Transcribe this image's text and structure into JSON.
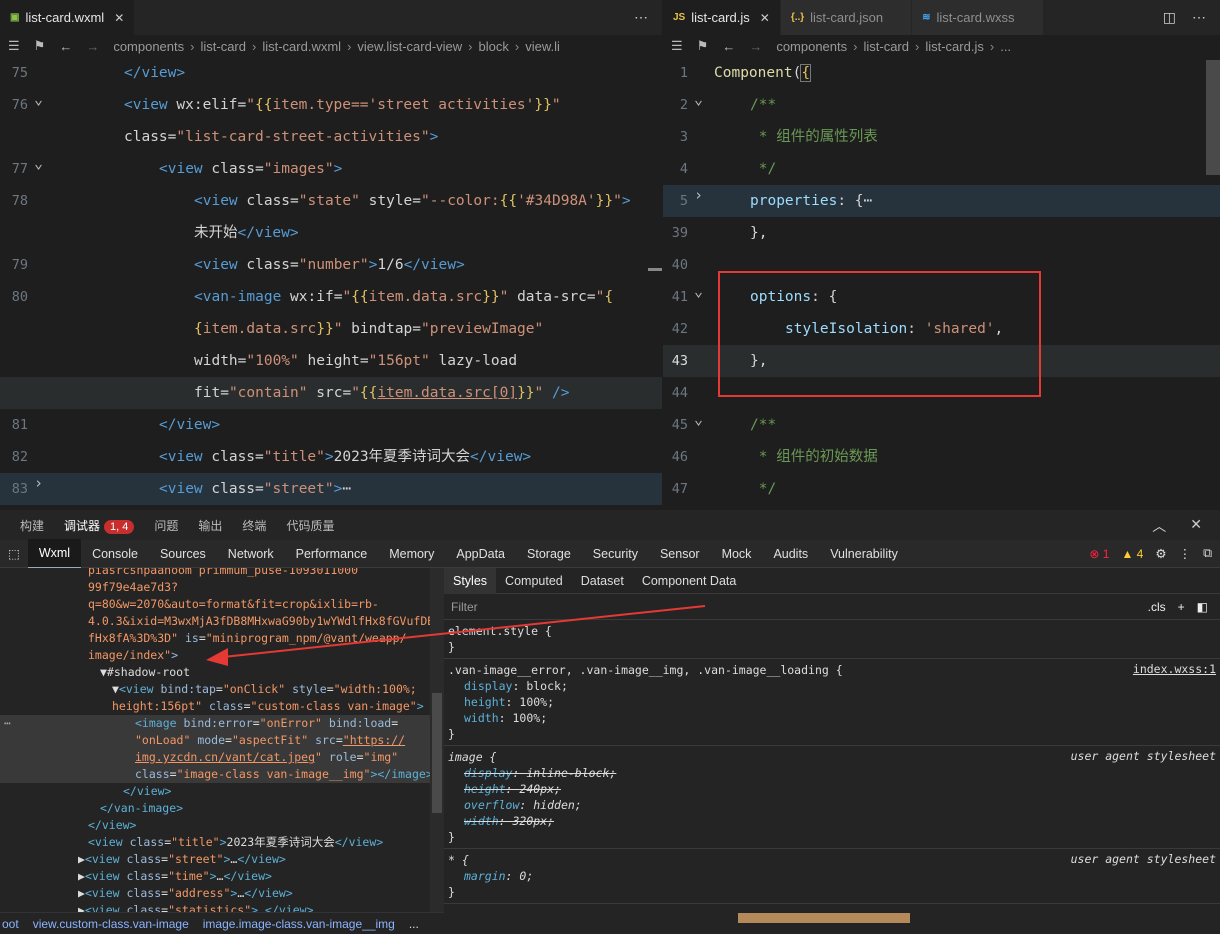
{
  "left_editor": {
    "tab": {
      "icon": "wxml-icon",
      "label": "list-card.wxml"
    },
    "breadcrumb": [
      "components",
      "list-card",
      "list-card.wxml",
      "view.list-card-view",
      "block",
      "view.li"
    ],
    "lines": [
      {
        "num": "75",
        "fold": "",
        "html": "<span class='t'>&lt;/view&gt;</span>",
        "indent": 124
      },
      {
        "num": "76",
        "fold": "v",
        "html": "<span class='t'>&lt;view</span> <span class='attr'>wx:elif</span><span class='w'>=</span><span class='s'>\"</span><span class='br'>{{</span><span class='s'>item.type=='street activities'</span><span class='br'>}}</span><span class='s'>\"</span>",
        "indent": 124
      },
      {
        "num": "",
        "fold": "",
        "html": "<span class='attr'>class</span><span class='w'>=</span><span class='s'>\"list-card-street-activities\"</span><span class='t'>&gt;</span>",
        "indent": 124
      },
      {
        "num": "77",
        "fold": "v",
        "html": "<span class='t'>&lt;view</span> <span class='attr'>class</span><span class='w'>=</span><span class='s'>\"images\"</span><span class='t'>&gt;</span>",
        "indent": 159
      },
      {
        "num": "78",
        "fold": "",
        "html": "<span class='t'>&lt;view</span> <span class='attr'>class</span><span class='w'>=</span><span class='s'>\"state\"</span> <span class='attr'>style</span><span class='w'>=</span><span class='s'>\"--color:</span><span class='br'>{{</span><span class='s'>'#34D98A'</span><span class='br'>}}</span><span class='s'>\"</span><span class='t'>&gt;</span>",
        "indent": 194
      },
      {
        "num": "",
        "fold": "",
        "html": "<span class='w'>未开始</span><span class='t'>&lt;/view&gt;</span>",
        "indent": 194
      },
      {
        "num": "79",
        "fold": "",
        "html": "<span class='t'>&lt;view</span> <span class='attr'>class</span><span class='w'>=</span><span class='s'>\"number\"</span><span class='t'>&gt;</span><span class='w'>1/6</span><span class='t'>&lt;/view&gt;</span>",
        "indent": 194
      },
      {
        "num": "80",
        "fold": "",
        "html": "<span class='t'>&lt;van-image</span> <span class='attr'>wx:if</span><span class='w'>=</span><span class='s'>\"</span><span class='br'>{{</span><span class='s'>item.data.src</span><span class='br'>}}</span><span class='s'>\"</span> <span class='attr'>data-src</span><span class='w'>=</span><span class='s'>\"</span><span class='br'>{</span>",
        "indent": 194
      },
      {
        "num": "",
        "fold": "",
        "html": "<span class='br'>{</span><span class='s'>item.data.src</span><span class='br'>}}</span><span class='s'>\"</span> <span class='attr'>bindtap</span><span class='w'>=</span><span class='s'>\"previewImage\"</span>",
        "indent": 194
      },
      {
        "num": "",
        "fold": "",
        "html": "<span class='attr'>width</span><span class='w'>=</span><span class='s'>\"100%\"</span> <span class='attr'>height</span><span class='w'>=</span><span class='s'>\"156pt\"</span> <span class='attr'>lazy-load</span>",
        "indent": 194
      },
      {
        "num": "",
        "fold": "",
        "html": "<span class='attr'>fit</span><span class='w'>=</span><span class='s'>\"contain\"</span> <span class='attr'>src</span><span class='w'>=</span><span class='s'>\"</span><span class='br'>{{</span><span class='s' style='text-decoration:underline'>item.data.src[0]</span><span class='br'>}}</span><span class='s'>\"</span> <span class='t'>/&gt;</span>",
        "indent": 194,
        "hl": true
      },
      {
        "num": "81",
        "fold": "",
        "html": "<span class='t'>&lt;/view&gt;</span>",
        "indent": 159
      },
      {
        "num": "82",
        "fold": "",
        "html": "<span class='t'>&lt;view</span> <span class='attr'>class</span><span class='w'>=</span><span class='s'>\"title\"</span><span class='t'>&gt;</span><span class='w'>2023年夏季诗词大会</span><span class='t'>&lt;/view&gt;</span>",
        "indent": 159
      },
      {
        "num": "83",
        "fold": ">",
        "html": "<span class='t'>&lt;view</span> <span class='attr'>class</span><span class='w'>=</span><span class='s'>\"street\"</span><span class='t'>&gt;</span><span class='w'>⋯</span>",
        "indent": 159,
        "sel": true
      }
    ]
  },
  "right_editor": {
    "tabs": [
      {
        "icon": "JS",
        "label": "list-card.js",
        "active": true
      },
      {
        "icon": "{..}",
        "label": "list-card.json",
        "active": false
      },
      {
        "icon": "≋",
        "label": "list-card.wxss",
        "active": false
      }
    ],
    "breadcrumb": [
      "components",
      "list-card",
      "list-card.js",
      "..."
    ],
    "lines": [
      {
        "num": "1",
        "fold": "",
        "html": "<span class='k'>Component</span><span class='w'>(</span><span class='br' style='outline:1px solid #777'>{</span>",
        "indent": 714
      },
      {
        "num": "2",
        "fold": "v",
        "html": "<span class='c'>/**</span>",
        "indent": 750
      },
      {
        "num": "3",
        "fold": "",
        "html": "<span class='c'> * 组件的属性列表</span>",
        "indent": 750
      },
      {
        "num": "4",
        "fold": "",
        "html": "<span class='c'> */</span>",
        "indent": 750
      },
      {
        "num": "5",
        "fold": ">",
        "html": "<span class='p'>properties</span><span class='w'>: {</span><span class='w'>⋯</span>",
        "indent": 750,
        "sel": true
      },
      {
        "num": "39",
        "fold": "",
        "html": "<span class='w'>},</span>",
        "indent": 750
      },
      {
        "num": "40",
        "fold": "",
        "html": "",
        "indent": 750
      },
      {
        "num": "41",
        "fold": "v",
        "html": "<span class='p'>options</span><span class='w'>: {</span>",
        "indent": 750
      },
      {
        "num": "42",
        "fold": "",
        "html": "<span class='p'>styleIsolation</span><span class='w'>: </span><span class='str'>'shared'</span><span class='w'>,</span>",
        "indent": 785
      },
      {
        "num": "43",
        "fold": "",
        "html": "<span class='w'>},</span>",
        "indent": 750,
        "hl": true,
        "cur": true
      },
      {
        "num": "44",
        "fold": "",
        "html": "",
        "indent": 750
      },
      {
        "num": "45",
        "fold": "v",
        "html": "<span class='c'>/**</span>",
        "indent": 750
      },
      {
        "num": "46",
        "fold": "",
        "html": "<span class='c'> * 组件的初始数据</span>",
        "indent": 750
      },
      {
        "num": "47",
        "fold": "",
        "html": "<span class='c'> */</span>",
        "indent": 750
      }
    ]
  },
  "panel": {
    "tabs": [
      "构建",
      "调试器",
      "问题",
      "输出",
      "终端",
      "代码质量"
    ],
    "active_tab": "调试器",
    "badge": "1, 4",
    "devtools_tabs": [
      "Wxml",
      "Console",
      "Sources",
      "Network",
      "Performance",
      "Memory",
      "AppData",
      "Storage",
      "Security",
      "Sensor",
      "Mock",
      "Audits",
      "Vulnerability"
    ],
    "errors": "1",
    "warnings": "4"
  },
  "elements": [
    {
      "indent": 88,
      "html": "<span class='ev'>99f79e4ae7d3?</span>"
    },
    {
      "indent": 88,
      "html": "<span class='ev'>q=80&amp;w=2070&amp;auto=format&amp;fit=crop&amp;ixlib=rb-</span>"
    },
    {
      "indent": 88,
      "html": "<span class='ev'>4.0.3&amp;ixid=M3wxMjA3fDB8MHxwaG90by1wYWdlfHx8fGVufDB8</span>"
    },
    {
      "indent": 88,
      "html": "<span class='ev'>fHx8fA%3D%3D\"</span> <span class='ea'>is</span><span class='etx'>=</span><span class='ev'>\"miniprogram_npm/@vant/weapp/</span>"
    },
    {
      "indent": 88,
      "html": "<span class='ev'>image/index\"</span><span class='ec'>&gt;</span>"
    },
    {
      "indent": 100,
      "html": "<span class='etx'>▼#shadow-root</span>"
    },
    {
      "indent": 112,
      "html": "<span class='etx'>▼</span><span class='et'>&lt;view</span> <span class='ea'>bind:tap</span><span class='etx'>=</span><span class='ev'>\"onClick\"</span> <span class='ea'>style</span><span class='etx'>=</span><span class='ev'>\"width:100%;</span>"
    },
    {
      "indent": 112,
      "html": "<span class='ev'>height:156pt\"</span> <span class='ea'>class</span><span class='etx'>=</span><span class='ev'>\"custom-class van-image\"</span><span class='et'>&gt;</span>"
    },
    {
      "indent": 135,
      "html": "<span class='et'>&lt;image</span> <span class='ea'>bind:error</span><span class='etx'>=</span><span class='ev'>\"onError\"</span> <span class='ea'>bind:load</span><span class='etx'>=</span>",
      "sel": true
    },
    {
      "indent": 135,
      "html": "<span class='ev'>\"onLoad\"</span> <span class='ea'>mode</span><span class='etx'>=</span><span class='ev'>\"aspectFit\"</span> <span class='ea'>src</span><span class='etx'>=</span><span class='ev' style='text-decoration:underline'>\"https://</span>",
      "sel": true
    },
    {
      "indent": 135,
      "html": "<span class='ev' style='text-decoration:underline'>img.yzcdn.cn/vant/cat.jpeg</span><span class='ev'>\"</span> <span class='ea'>role</span><span class='etx'>=</span><span class='ev'>\"img\"</span>",
      "sel": true
    },
    {
      "indent": 135,
      "html": "<span class='ea'>class</span><span class='etx'>=</span><span class='ev'>\"image-class van-image__img\"</span><span class='et'>&gt;&lt;/image&gt;</span>",
      "sel": true
    },
    {
      "indent": 123,
      "html": "<span class='et'>&lt;/view&gt;</span>"
    },
    {
      "indent": 100,
      "html": "<span class='et'>&lt;/van-image&gt;</span>"
    },
    {
      "indent": 88,
      "html": "<span class='et'>&lt;/view&gt;</span>"
    },
    {
      "indent": 88,
      "html": "<span class='et'>&lt;view</span> <span class='ea'>class</span><span class='etx'>=</span><span class='ev'>\"title\"</span><span class='et'>&gt;</span><span class='etx'>2023年夏季诗词大会</span><span class='et'>&lt;/view&gt;</span>"
    },
    {
      "indent": 78,
      "html": "<span class='etx'>▶</span><span class='et'>&lt;view</span> <span class='ea'>class</span><span class='etx'>=</span><span class='ev'>\"street\"</span><span class='et'>&gt;</span><span class='etx'>…</span><span class='et'>&lt;/view&gt;</span>"
    },
    {
      "indent": 78,
      "html": "<span class='etx'>▶</span><span class='et'>&lt;view</span> <span class='ea'>class</span><span class='etx'>=</span><span class='ev'>\"time\"</span><span class='et'>&gt;</span><span class='etx'>…</span><span class='et'>&lt;/view&gt;</span>"
    },
    {
      "indent": 78,
      "html": "<span class='etx'>▶</span><span class='et'>&lt;view</span> <span class='ea'>class</span><span class='etx'>=</span><span class='ev'>\"address\"</span><span class='et'>&gt;</span><span class='etx'>…</span><span class='et'>&lt;/view&gt;</span>"
    },
    {
      "indent": 78,
      "html": "<span class='etx'>▶</span><span class='et'>&lt;view</span> <span class='ea'>class</span><span class='etx'>=</span><span class='ev'>\"statistics\"</span><span class='et'>&gt;</span><span class='etx'>…</span><span class='et'>&lt;/view&gt;</span>"
    }
  ],
  "status_path": [
    "oot",
    "view.custom-class.van-image",
    "image.image-class.van-image__img",
    "..."
  ],
  "styles": {
    "tabs": [
      "Styles",
      "Computed",
      "Dataset",
      "Component Data"
    ],
    "filter_placeholder": "Filter",
    "cls": ".cls",
    "rules": [
      {
        "selector": "element.style {",
        "source": "",
        "props": []
      },
      {
        "selector": ".van-image__error, .van-image__img, .van-image__loading {",
        "source": "index.wxss:1",
        "props": [
          [
            "display",
            "block"
          ],
          [
            "height",
            "100%"
          ],
          [
            "width",
            "100%"
          ]
        ]
      },
      {
        "selector": "image {",
        "source": "user agent stylesheet",
        "ua": true,
        "props": [
          [
            "display",
            "inline-block",
            "x"
          ],
          [
            "height",
            "240px",
            "x"
          ],
          [
            "overflow",
            "hidden"
          ],
          [
            "width",
            "320px",
            "x"
          ]
        ]
      },
      {
        "selector": "* {",
        "source": "user agent stylesheet",
        "ua": true,
        "props": [
          [
            "margin",
            "0"
          ]
        ]
      }
    ]
  }
}
